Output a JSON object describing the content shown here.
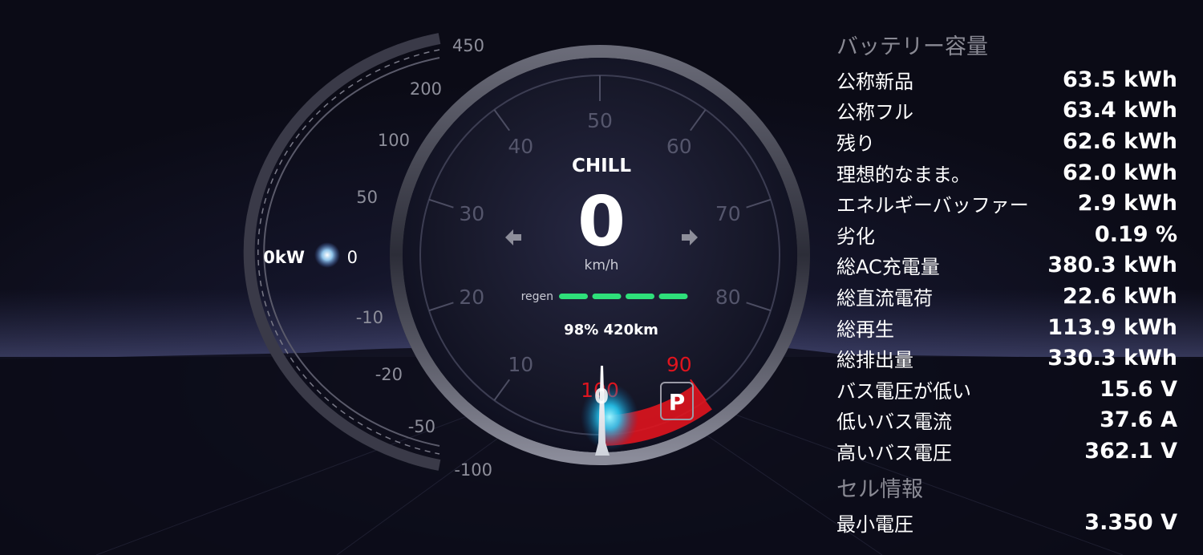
{
  "power_scale": {
    "current_label": "0kW",
    "ticks": [
      {
        "value": 450,
        "label": "450"
      },
      {
        "value": 200,
        "label": "200"
      },
      {
        "value": 100,
        "label": "100"
      },
      {
        "value": 50,
        "label": "50"
      },
      {
        "value": 0,
        "label": "0"
      },
      {
        "value": -10,
        "label": "-10"
      },
      {
        "value": -20,
        "label": "-20"
      },
      {
        "value": -50,
        "label": "-50"
      },
      {
        "value": -100,
        "label": "-100"
      }
    ]
  },
  "speedometer": {
    "drive_mode": "CHILL",
    "speed": "0",
    "unit": "km/h",
    "regen_label": "regen",
    "regen_segments": 4,
    "battery_range": "98% 420km",
    "gear": "P",
    "needle_value": 0,
    "ticks": [
      {
        "value": 0,
        "label": "0"
      },
      {
        "value": 10,
        "label": "10"
      },
      {
        "value": 20,
        "label": "20"
      },
      {
        "value": 30,
        "label": "30"
      },
      {
        "value": 40,
        "label": "40"
      },
      {
        "value": 50,
        "label": "50"
      },
      {
        "value": 60,
        "label": "60"
      },
      {
        "value": 70,
        "label": "70"
      },
      {
        "value": 80,
        "label": "80"
      },
      {
        "value": 90,
        "label": "90"
      },
      {
        "value": 100,
        "label": "100"
      }
    ],
    "redline_from": 90,
    "colors": {
      "redline": "#e0141e",
      "regen": "#2ee07a",
      "glow": "#27d3ff"
    }
  },
  "battery": {
    "title": "バッテリー容量",
    "rows": [
      {
        "label": "公称新品",
        "value": "63.5 kWh"
      },
      {
        "label": "公称フル",
        "value": "63.4 kWh"
      },
      {
        "label": "残り",
        "value": "62.6 kWh"
      },
      {
        "label": "理想的なまま。",
        "value": "62.0 kWh"
      },
      {
        "label": "エネルギーバッファー",
        "value": "2.9 kWh"
      },
      {
        "label": "劣化",
        "value": "0.19 %"
      },
      {
        "label": "総AC充電量",
        "value": "380.3 kWh"
      },
      {
        "label": "総直流電荷",
        "value": "22.6 kWh"
      },
      {
        "label": "総再生",
        "value": "113.9 kWh"
      },
      {
        "label": "総排出量",
        "value": "330.3 kWh"
      },
      {
        "label": "バス電圧が低い",
        "value": "15.6 V"
      },
      {
        "label": "低いバス電流",
        "value": "37.6 A"
      },
      {
        "label": "高いバス電圧",
        "value": "362.1 V"
      }
    ]
  },
  "cell": {
    "title": "セル情報",
    "rows": [
      {
        "label": "最小電圧",
        "value": "3.350 V"
      }
    ]
  }
}
